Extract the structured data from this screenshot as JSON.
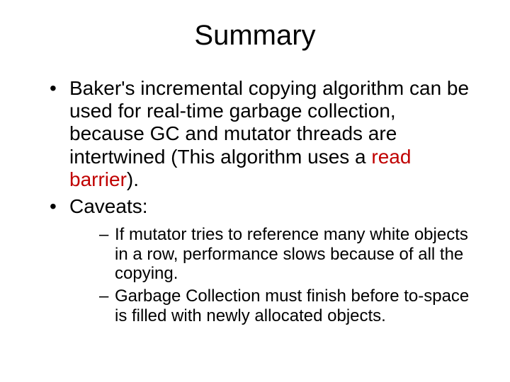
{
  "title": "Summary",
  "bullets": [
    {
      "pre": "Baker's incremental copying algorithm can be used for real-time garbage collection, because GC and mutator threads are intertwined (This algorithm uses a ",
      "hl": "read barrier",
      "post": ")."
    },
    {
      "pre": "Caveats:",
      "hl": "",
      "post": ""
    }
  ],
  "subbullets": [
    "If mutator tries to reference many white objects in a row, performance slows because of all the copying.",
    "Garbage Collection must finish before to-space is filled with newly allocated objects."
  ]
}
